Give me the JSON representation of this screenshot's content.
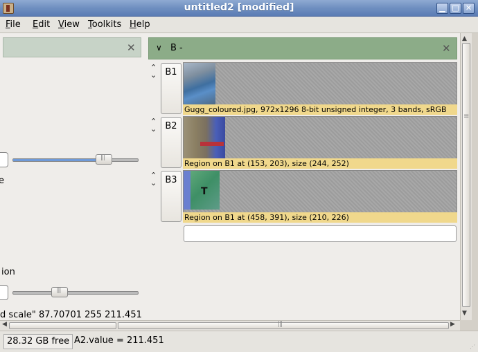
{
  "window": {
    "title": "untitled2 [modified]",
    "icon": "app-icon",
    "controls": {
      "minimize": "▁",
      "maximize": "□",
      "close": "✕"
    }
  },
  "menu": [
    {
      "label": "File"
    },
    {
      "label": "Edit"
    },
    {
      "label": "View"
    },
    {
      "label": "Toolkits"
    },
    {
      "label": "Help"
    }
  ],
  "left_pane": {
    "close_icon": "✕",
    "partial_text_1": "e",
    "partial_text_2": "ion",
    "partial_text_3": "d scale\" 87.70701 255 211.451",
    "slider1_fraction": 0.72,
    "slider2_fraction": 0.37
  },
  "group": {
    "chevron": "∨",
    "title": "B -",
    "close_icon": "✕"
  },
  "rows": [
    {
      "label": "B1",
      "caption": "Gugg_coloured.jpg, 972x1296 8-bit unsigned integer, 3 bands, sRGB"
    },
    {
      "label": "B2",
      "caption": "Region on B1 at (153, 203), size (244, 252)"
    },
    {
      "label": "B3",
      "caption": "Region on B1 at (458, 391), size (210, 226)"
    }
  ],
  "row_arrows": {
    "up": "⌃",
    "down": "⌄"
  },
  "new_row_input": {
    "value": ""
  },
  "scroll": {
    "up": "▲",
    "down": "▼",
    "left": "◀",
    "right": "▶"
  },
  "status": {
    "free_space": "28.32 GB free",
    "value": "A2.value = 211.451"
  }
}
